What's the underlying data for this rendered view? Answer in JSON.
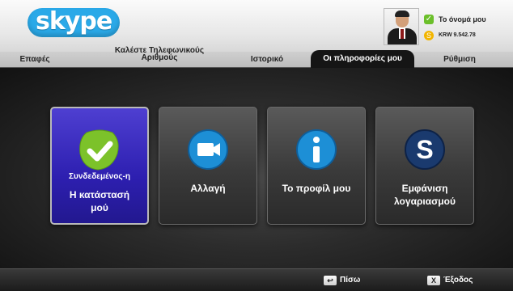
{
  "app": {
    "logo_text": "skype"
  },
  "profile": {
    "name": "Το όνομά μου",
    "credit": "KRW 9.542.78"
  },
  "tabs": [
    {
      "label": "Επαφές"
    },
    {
      "label_line1": "Καλέστε Τηλεφωνικούς",
      "label_line2": "Αριθμούς"
    },
    {
      "label": "Ιστορικό"
    },
    {
      "label": "Οι πληροφορίες μου",
      "active": true
    },
    {
      "label": "Ρύθμιση"
    }
  ],
  "tiles": [
    {
      "sublabel": "Συνδεδεμένος-η",
      "label_line1": "Η κατάστασή",
      "label_line2": "μού",
      "icon": "check-status-icon",
      "selected": true
    },
    {
      "label_line1": "Αλλαγή",
      "label_line2": "",
      "icon": "video-camera-icon"
    },
    {
      "label_line1": "Το προφίλ μου",
      "label_line2": "",
      "icon": "info-icon"
    },
    {
      "label_line1": "Εμφάνιση",
      "label_line2": "λογαριασμού",
      "icon": "skype-s-icon"
    }
  ],
  "footer": {
    "back": {
      "key": "↩",
      "label": "Πίσω"
    },
    "exit": {
      "key": "X",
      "label": "Έξοδος"
    }
  },
  "colors": {
    "accent": "#2aa9e8",
    "selected_tile": "#2d1fb0",
    "status_green": "#6bbf2a",
    "credit_gold": "#f2b500"
  }
}
